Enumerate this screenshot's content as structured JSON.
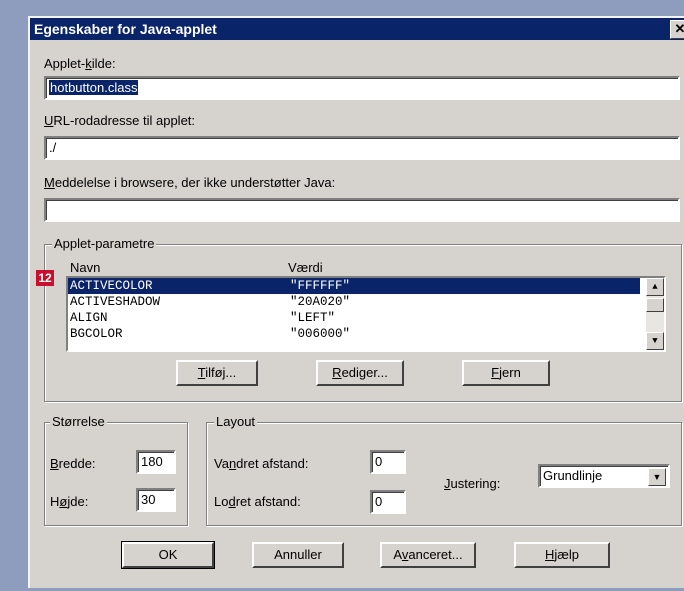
{
  "window": {
    "title": "Egenskaber for Java-applet",
    "close_glyph": "✕"
  },
  "fields": {
    "applet_source": {
      "label_pre": "Applet-",
      "label_u": "k",
      "label_post": "ilde:",
      "value": "hotbutton.class"
    },
    "url_base": {
      "label_pre": "",
      "label_u": "U",
      "label_post": "RL-rodadresse til applet:",
      "value": "./"
    },
    "message": {
      "label_pre": "",
      "label_u": "M",
      "label_post": "eddelelse i browsere, der ikke understøtter Java:",
      "value": ""
    }
  },
  "params": {
    "group_title": "Applet-parametre",
    "badge": "12",
    "col_name": "Navn",
    "col_value": "Værdi",
    "rows": [
      {
        "name": "ACTIVECOLOR",
        "value": "\"FFFFFF\""
      },
      {
        "name": "ACTIVESHADOW",
        "value": "\"20A020\""
      },
      {
        "name": "ALIGN",
        "value": "\"LEFT\""
      },
      {
        "name": "BGCOLOR",
        "value": "\"006000\""
      }
    ],
    "buttons": {
      "add": {
        "u": "T",
        "rest": "ilføj..."
      },
      "edit": {
        "u": "R",
        "rest": "ediger..."
      },
      "remove": {
        "u": "F",
        "rest": "jern"
      }
    }
  },
  "size": {
    "group_title": "Størrelse",
    "width_label": {
      "u": "B",
      "rest": "redde:"
    },
    "width_value": "180",
    "height_label": {
      "pre": "H",
      "u": "ø",
      "rest": "jde:"
    },
    "height_value": "30"
  },
  "layout": {
    "group_title": "Layout",
    "hspace_label": {
      "pre": "Va",
      "u": "n",
      "rest": "dret afstand:"
    },
    "hspace_value": "0",
    "vspace_label": {
      "pre": "Lo",
      "u": "d",
      "rest": "ret afstand:"
    },
    "vspace_value": "0",
    "align_label": {
      "u": "J",
      "rest": "ustering:"
    },
    "align_value": "Grundlinje"
  },
  "footer": {
    "ok": "OK",
    "cancel": "Annuller",
    "advanced": {
      "pre": "A",
      "u": "v",
      "rest": "anceret..."
    },
    "help": {
      "u": "H",
      "rest": "jælp"
    }
  },
  "colors": {
    "selection": "#0a246a",
    "badge": "#c8102e",
    "dialog": "#d6d3ce",
    "backdrop": "#8e9cbd"
  }
}
